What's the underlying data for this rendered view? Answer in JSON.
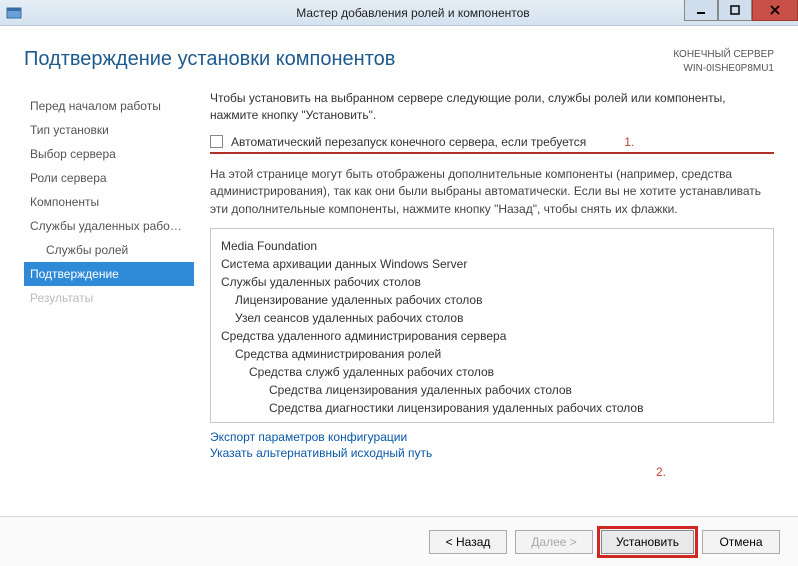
{
  "titlebar": {
    "title": "Мастер добавления ролей и компонентов"
  },
  "header": {
    "title": "Подтверждение установки компонентов",
    "server_label": "КОНЕЧНЫЙ СЕРВЕР",
    "server_name": "WIN-0ISHE0P8MU1"
  },
  "sidebar": {
    "items": [
      "Перед началом работы",
      "Тип установки",
      "Выбор сервера",
      "Роли сервера",
      "Компоненты",
      "Службы удаленных рабо…",
      "Службы ролей",
      "Подтверждение",
      "Результаты"
    ]
  },
  "main": {
    "intro": "Чтобы установить на выбранном сервере следующие роли, службы ролей или компоненты, нажмите кнопку \"Установить\".",
    "checkbox_label": "Автоматический перезапуск конечного сервера, если требуется",
    "annot1": "1.",
    "note": "На этой странице могут быть отображены дополнительные компоненты (например, средства администрирования), так как они были выбраны автоматически. Если вы не хотите устанавливать эти дополнительные компоненты, нажмите кнопку \"Назад\", чтобы снять их флажки.",
    "list": [
      {
        "level": 0,
        "text": "Media Foundation"
      },
      {
        "level": 0,
        "text": "Система архивации данных Windows Server"
      },
      {
        "level": 0,
        "text": "Службы удаленных рабочих столов"
      },
      {
        "level": 1,
        "text": "Лицензирование удаленных рабочих столов"
      },
      {
        "level": 1,
        "text": "Узел сеансов удаленных рабочих столов"
      },
      {
        "level": 0,
        "text": "Средства удаленного администрирования сервера"
      },
      {
        "level": 1,
        "text": "Средства администрирования ролей"
      },
      {
        "level": 2,
        "text": "Средства служб удаленных рабочих столов"
      },
      {
        "level": 3,
        "text": "Средства лицензирования удаленных рабочих столов"
      },
      {
        "level": 3,
        "text": "Средства диагностики лицензирования удаленных рабочих столов"
      }
    ],
    "link1": "Экспорт параметров конфигурации",
    "link2": "Указать альтернативный исходный путь",
    "annot2": "2."
  },
  "footer": {
    "back": "< Назад",
    "next": "Далее >",
    "install": "Установить",
    "cancel": "Отмена"
  }
}
